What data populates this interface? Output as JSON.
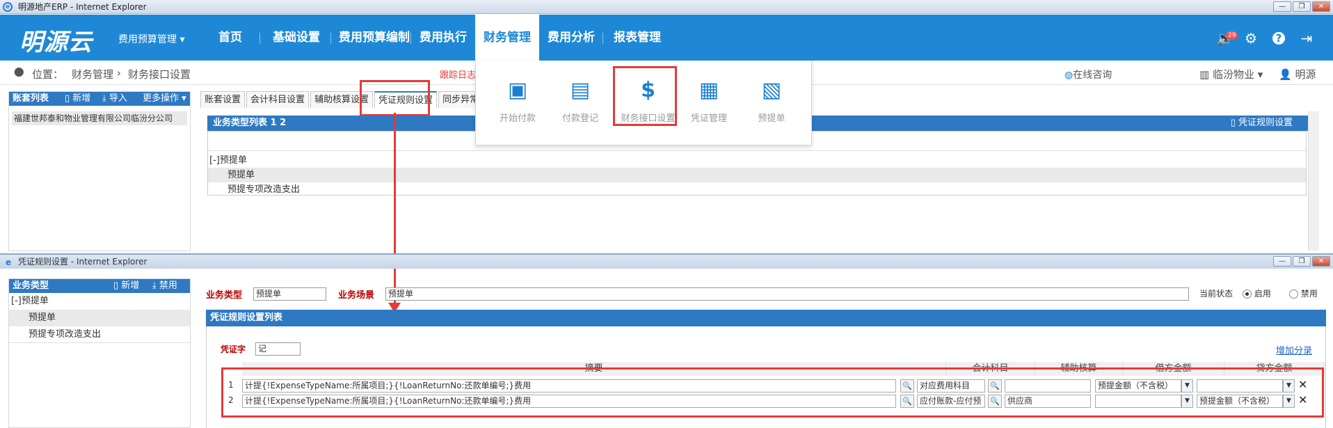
{
  "browser": {
    "title": "明源地产ERP - Internet Explorer"
  },
  "topnav": {
    "logo": "明源云",
    "module_selector": "费用预算管理",
    "items": [
      "首页",
      "基础设置",
      "费用预算编制",
      "费用执行",
      "财务管理",
      "费用分析",
      "报表管理"
    ],
    "active": "财务管理",
    "notify_count": "29"
  },
  "breadcrumb": {
    "prefix": "位置：",
    "items": [
      "财务管理",
      "财务接口设置"
    ],
    "trace": "跟踪日志",
    "consult": "在线咨询",
    "company": "临汾物业",
    "user": "明源"
  },
  "dropdown": {
    "items": [
      {
        "label": "开始付款",
        "icon": "payment-icon"
      },
      {
        "label": "付款登记",
        "icon": "register-icon"
      },
      {
        "label": "财务接口设置",
        "icon": "dollar-plug-icon"
      },
      {
        "label": "凭证管理",
        "icon": "voucher-icon"
      },
      {
        "label": "预提单",
        "icon": "accrual-icon"
      }
    ]
  },
  "account_panel": {
    "title": "账套列表",
    "add": "新增",
    "import": "导入",
    "more": "更多操作",
    "item": "福建世邦泰和物业管理有限公司临汾分公司"
  },
  "tabs": [
    "账套设置",
    "会计科目设置",
    "辅助核算设置",
    "凭证规则设置",
    "同步异常日"
  ],
  "active_tab": "凭证规则设置",
  "biz_list": {
    "title": "业务类型列表 1 2",
    "rule_setting": "凭证规则设置",
    "rows": [
      "[-]预提单",
      "预提单",
      "预提专项改造支出"
    ]
  },
  "dialog": {
    "title": "凭证规则设置 - Internet Explorer",
    "left": {
      "title": "业务类型",
      "add": "新增",
      "disable": "禁用",
      "tree": [
        "[-]预提单",
        "预提单",
        "预提专项改造支出"
      ]
    },
    "biz_type_label": "业务类型",
    "biz_type_value": "预提单",
    "biz_scene_label": "业务场景",
    "biz_scene_value": "预提单",
    "status_label": "当前状态",
    "enable": "启用",
    "disable": "禁用",
    "section": "凭证规则设置列表",
    "voucher_word_label": "凭证字",
    "voucher_word_value": "记",
    "add_entry": "增加分录",
    "columns": [
      "摘要",
      "会计科目",
      "辅助核算",
      "借方金额",
      "贷方金额"
    ],
    "rows": [
      {
        "no": "1",
        "summary": "计提{!ExpenseTypeName:所属项目;}{!LoanReturnNo:还款单编号;}费用",
        "account": "对应费用科目",
        "aux": "",
        "debit": "预提金额（不含税）",
        "credit": ""
      },
      {
        "no": "2",
        "summary": "计提{!ExpenseTypeName:所属项目;}{!LoanReturnNo:还款单编号;}费用",
        "account": "应付账款-应付预",
        "aux": "供应商",
        "debit": "",
        "credit": "预提金额（不含税）"
      }
    ]
  }
}
